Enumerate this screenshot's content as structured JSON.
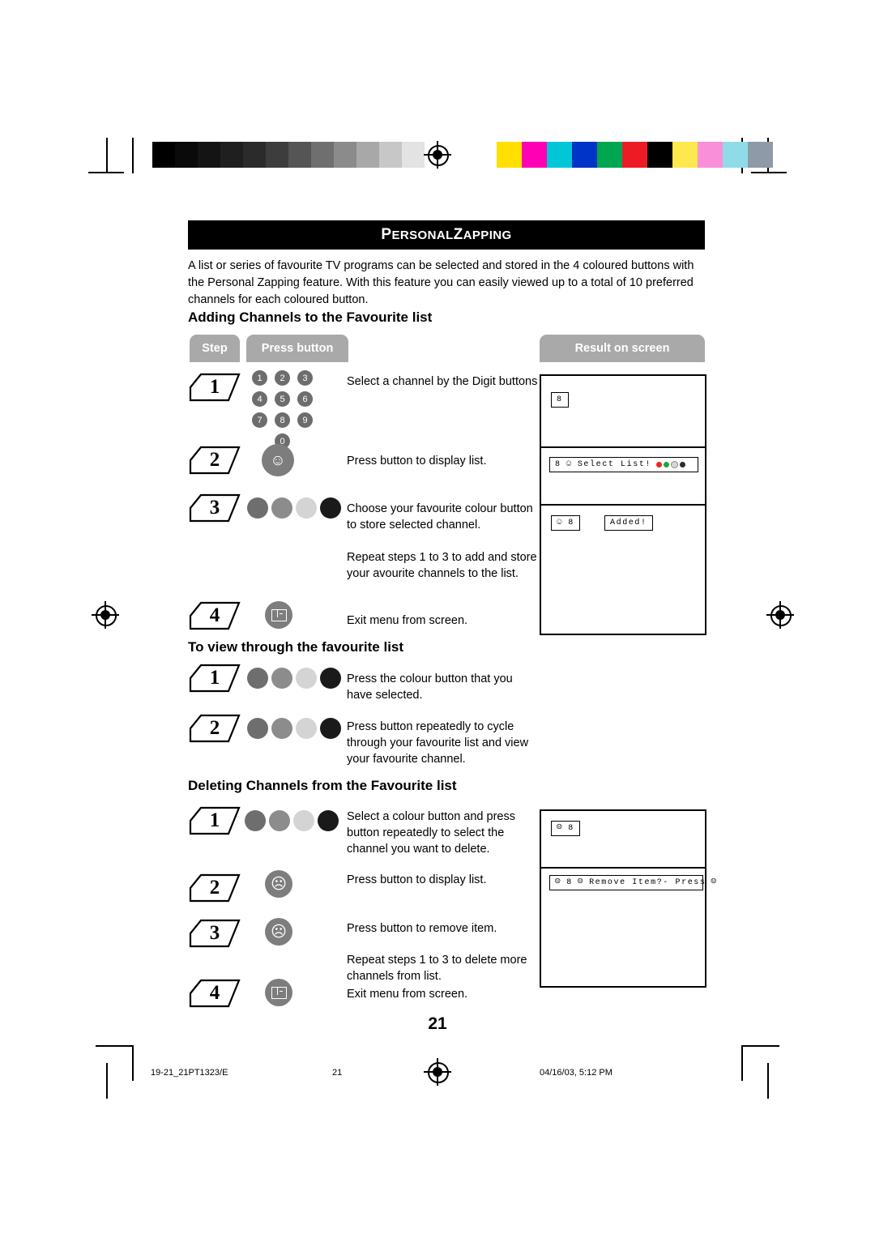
{
  "page": {
    "title": "PERSONAL ZAPPING",
    "title_first_letters": {
      "p": "P",
      "rest1": "ERSONAL ",
      "z": "Z",
      "rest2": "APPING"
    },
    "number": "21",
    "intro": "A list or series of favourite TV programs can be selected and stored in the 4 coloured buttons with the Personal Zapping feature. With this feature you can easily viewed up to a total of 10 preferred channels for each coloured button."
  },
  "headings": {
    "adding": "Adding Channels to the Favourite list",
    "viewing": "To view through the favourite list",
    "deleting": "Deleting Channels from the Favourite list"
  },
  "tabs": {
    "step": "Step",
    "press_button": "Press button",
    "result": "Result on screen"
  },
  "keypad": {
    "rows": [
      [
        "1",
        "2",
        "3"
      ],
      [
        "4",
        "5",
        "6"
      ],
      [
        "7",
        "8",
        "9"
      ]
    ],
    "zero": "0"
  },
  "colors": {
    "button_red": "#6e6e6e",
    "button_green": "#8c8c8c",
    "button_yellow": "#d4d4d4",
    "button_blue": "#1a1a1a",
    "osd_red": "#e8281e",
    "osd_green": "#23a638",
    "osd_yellow": "#d9d9d9",
    "osd_blue": "#2b2b2b",
    "tab_grey": "#a9a9a9",
    "button_grey": "#7d7d7d"
  },
  "adding_steps": [
    {
      "num": "1",
      "text": "Select a channel by the Digit buttons",
      "icon": "digit-keypad"
    },
    {
      "num": "2",
      "text": "Press button to display list.",
      "icon": "smiley-button"
    },
    {
      "num": "3",
      "text": "Choose your favourite colour button to store selected channel.",
      "icon": "colour-buttons"
    },
    {
      "num": "",
      "text": "Repeat steps 1 to 3 to add and store your avourite channels to the list.",
      "icon": ""
    },
    {
      "num": "4",
      "text": "Exit menu from screen.",
      "icon": "menu-button"
    }
  ],
  "viewing_steps": [
    {
      "num": "1",
      "text": "Press the colour button that you have selected.",
      "icon": "colour-buttons"
    },
    {
      "num": "2",
      "text": "Press button repeatedly to cycle through your favourite list and view your favourite channel.",
      "icon": "colour-buttons"
    }
  ],
  "deleting_steps": [
    {
      "num": "1",
      "text": "Select a colour button and press button repeatedly to select the channel you want to delete.",
      "icon": "colour-buttons"
    },
    {
      "num": "2",
      "text": "Press button to display list.",
      "icon": "sad-smiley-button"
    },
    {
      "num": "3",
      "text": "Press button to remove item.",
      "icon": "sad-smiley-button"
    },
    {
      "num": "",
      "text": "Repeat steps 1 to 3 to delete more channels from list.",
      "icon": ""
    },
    {
      "num": "4",
      "text": "Exit menu from screen.",
      "icon": "menu-button"
    }
  ],
  "screens": {
    "s1_channel": "8",
    "s2_channel": "8",
    "s2_text": "Select List!",
    "s3_channel": "8",
    "s3_text": "Added!",
    "s4_channel": "8",
    "s5_channel": "8",
    "s5_text": "Remove Item?- Press"
  },
  "footer": {
    "left": "19-21_21PT1323/E",
    "middle": "21",
    "right": "04/16/03, 5:12 PM"
  },
  "strips": {
    "gray": [
      "#000000",
      "#0a0a0a",
      "#141414",
      "#1f1f1f",
      "#2b2b2b",
      "#3d3d3d",
      "#555555",
      "#6f6f6f",
      "#8b8b8b",
      "#a8a8a8",
      "#c7c7c7",
      "#e3e3e3",
      "#ffffff"
    ],
    "color": [
      "#ffe000",
      "#ff00b4",
      "#00c6d8",
      "#0033c8",
      "#00a650",
      "#ed1c24",
      "#000000",
      "#ffe84d",
      "#f98fd8",
      "#8fdce8",
      "#8f9aa8"
    ]
  }
}
